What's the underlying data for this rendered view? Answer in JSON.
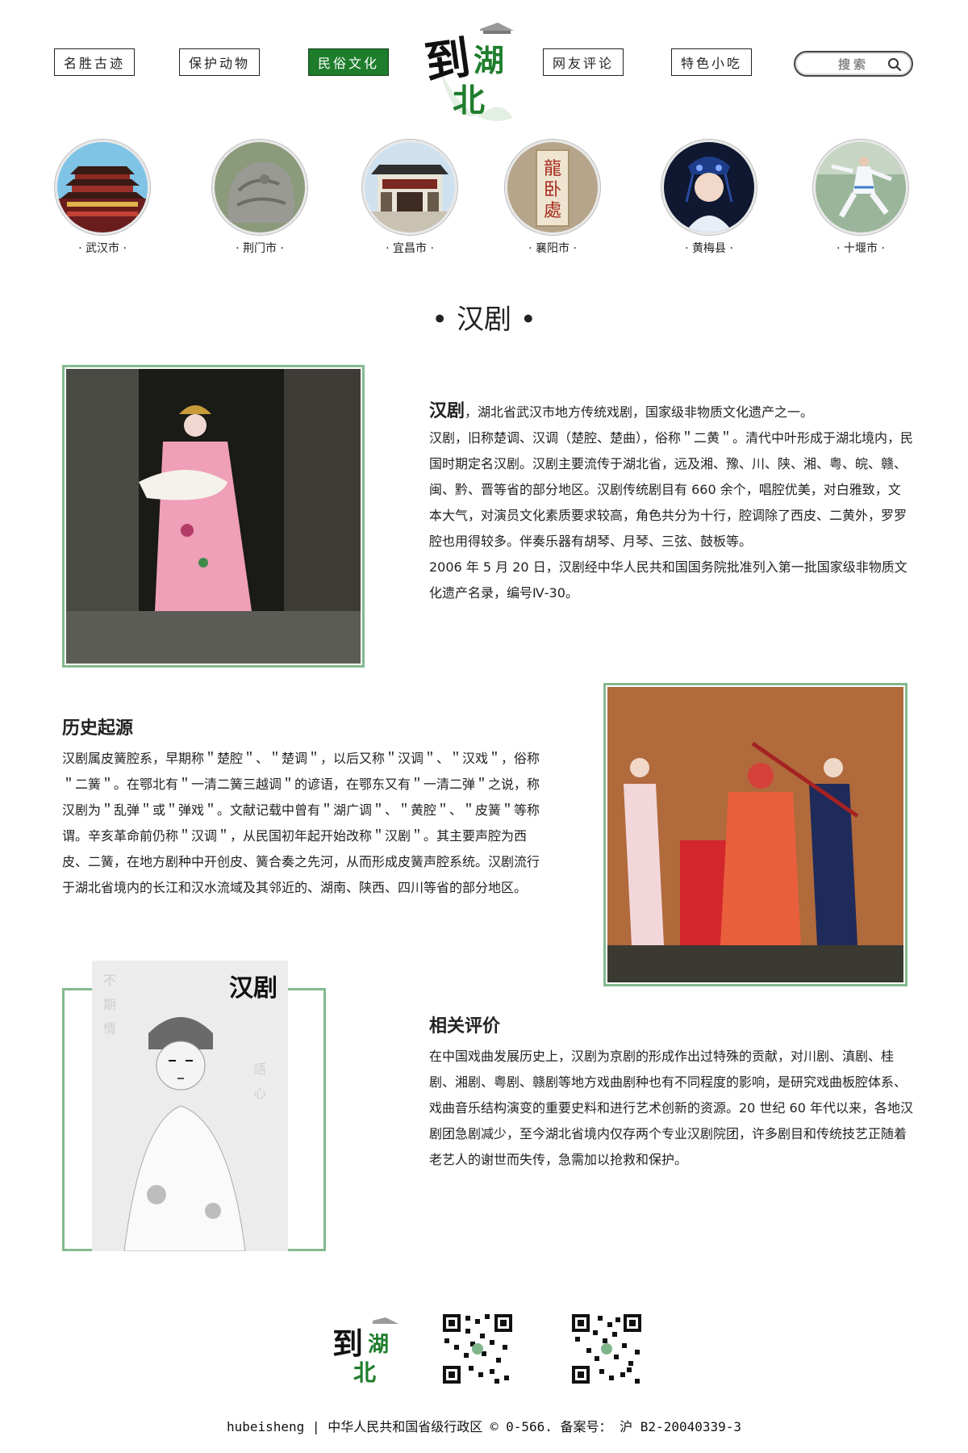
{
  "nav": {
    "items": [
      {
        "label": "名胜古迹"
      },
      {
        "label": "保护动物"
      },
      {
        "label": "民俗文化",
        "active": true
      },
      {
        "label": "网友评论"
      },
      {
        "label": "特色小吃"
      }
    ],
    "search_placeholder": "搜索"
  },
  "logo": {
    "text": "到湖北"
  },
  "cities": [
    {
      "label": "· 武汉市 ·"
    },
    {
      "label": "· 荆门市 ·"
    },
    {
      "label": "· 宜昌市 ·"
    },
    {
      "label": "· 襄阳市 ·"
    },
    {
      "label": "· 黄梅县 ·"
    },
    {
      "label": "· 十堰市 ·"
    }
  ],
  "section": {
    "title": "• 汉剧 •"
  },
  "intro": {
    "lead_strong": "汉剧",
    "lead_rest": "，湖北省武汉市地方传统戏剧，国家级非物质文化遗产之一。",
    "para1": "汉剧，旧称楚调、汉调（楚腔、楚曲），俗称＂二黄＂。清代中叶形成于湖北境内，民国时期定名汉剧。汉剧主要流传于湖北省，远及湘、豫、川、陕、湘、粤、皖、赣、闽、黔、晋等省的部分地区。汉剧传统剧目有 660 余个，唱腔优美，对白雅致，文本大气，对演员文化素质要求较高，角色共分为十行，腔调除了西皮、二黄外，罗罗腔也用得较多。伴奏乐器有胡琴、月琴、三弦、鼓板等。",
    "para2": "2006 年 5 月 20 日，汉剧经中华人民共和国国务院批准列入第一批国家级非物质文化遗产名录，编号Ⅳ-30。"
  },
  "history": {
    "title": "历史起源",
    "text": "汉剧属皮簧腔系，早期称＂楚腔＂、＂楚调＂，以后又称＂汉调＂、＂汉戏＂，俗称＂二簧＂。在鄂北有＂一清二簧三越调＂的谚语，在鄂东又有＂一清二弹＂之说，称汉剧为＂乱弹＂或＂弹戏＂。文献记载中曾有＂湖广调＂、＂黄腔＂、＂皮簧＂等称谓。辛亥革命前仍称＂汉调＂，从民国初年起开始改称＂汉剧＂。其主要声腔为西皮、二簧，在地方剧种中开创皮、簧合奏之先河，从而形成皮簧声腔系统。汉剧流行于湖北省境内的长江和汉水流域及其邻近的、湖南、陕西、四川等省的部分地区。"
  },
  "review": {
    "title": "相关评价",
    "text": "在中国戏曲发展历史上，汉剧为京剧的形成作出过特殊的贡献，对川剧、滇剧、桂剧、湘剧、粤剧、赣剧等地方戏曲剧种也有不同程度的影响，是研究戏曲板腔体系、戏曲音乐结构演变的重要史料和进行艺术创新的资源。20 世纪 60 年代以来，各地汉剧团急剧减少，至今湖北省境内仅存两个专业汉剧院团，许多剧目和传统技艺正随着老艺人的谢世而失传，急需加以抢救和保护。"
  },
  "poster": {
    "calligraphy": "汉剧"
  },
  "footer": {
    "text": "hubeisheng | 中华人民共和国省级行政区 © 0-566. 备案号： 沪 B2-20040339-3"
  },
  "colors": {
    "accent": "#1e7d2c",
    "frame": "#84b98f"
  }
}
